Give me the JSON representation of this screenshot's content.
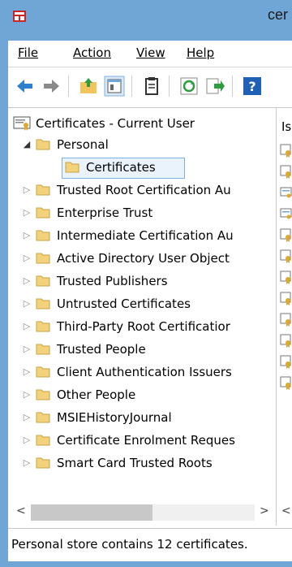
{
  "window": {
    "title_fragment": "cer",
    "accent": "#6fa6d6",
    "selection_color": "#7fb1e0"
  },
  "menu": {
    "file": "File",
    "action": "Action",
    "view": "View",
    "help": "Help"
  },
  "toolbar": {
    "icons": [
      "back-arrow-icon",
      "forward-arrow-icon",
      "up-folder-icon",
      "show-hide-tree-icon",
      "properties-icon",
      "refresh-icon",
      "export-list-icon",
      "help-icon"
    ]
  },
  "tree": {
    "root": "Certificates - Current User",
    "items": [
      {
        "label": "Personal",
        "expanded": true
      },
      {
        "label": "Certificates",
        "selected": true
      },
      {
        "label": "Trusted Root Certification Au"
      },
      {
        "label": "Enterprise Trust"
      },
      {
        "label": "Intermediate Certification Au"
      },
      {
        "label": "Active Directory User Object"
      },
      {
        "label": "Trusted Publishers"
      },
      {
        "label": "Untrusted Certificates"
      },
      {
        "label": "Third-Party Root Certificatior"
      },
      {
        "label": "Trusted People"
      },
      {
        "label": "Client Authentication Issuers"
      },
      {
        "label": "Other People"
      },
      {
        "label": "MSIEHistoryJournal"
      },
      {
        "label": "Certificate Enrolment Reques"
      },
      {
        "label": "Smart Card Trusted Roots"
      }
    ]
  },
  "right_pane": {
    "header_fragment": "Is"
  },
  "status": {
    "text": "Personal store contains 12 certificates."
  }
}
